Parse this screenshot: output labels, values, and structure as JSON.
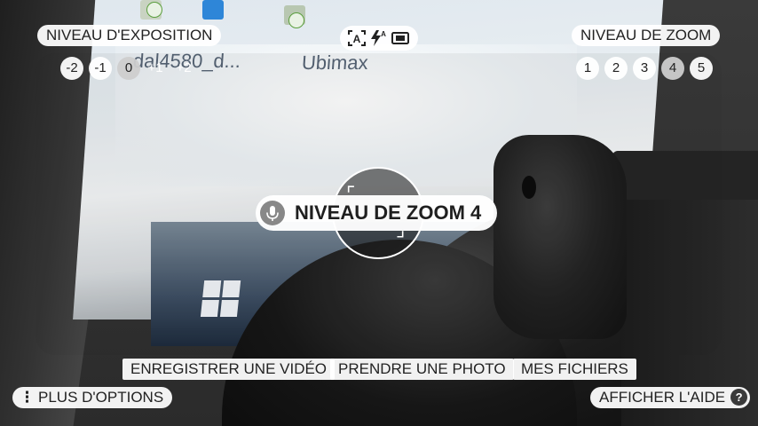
{
  "viewfinder": {
    "desktop_labels": [
      "dal4580_d...",
      "Ubimax"
    ]
  },
  "exposure": {
    "title": "NIVEAU D'EXPOSITION",
    "levels": [
      "-2",
      "-1",
      "0",
      "+1",
      "+2"
    ],
    "selected": "0"
  },
  "mode_icons": [
    "auto-focus-icon",
    "flash-auto-icon",
    "aspect-ratio-icon"
  ],
  "flash_auto_label": "A",
  "focus_auto_label": "A",
  "zoom": {
    "title": "NIVEAU DE ZOOM",
    "levels": [
      "1",
      "2",
      "3",
      "4",
      "5"
    ],
    "selected": "4"
  },
  "toast": {
    "text": "NIVEAU DE ZOOM 4",
    "icon": "microphone-icon"
  },
  "actions": {
    "record_video": "ENREGISTRER UNE VIDÉO",
    "take_photo": "PRENDRE UNE PHOTO",
    "my_files": "MES FICHIERS"
  },
  "more_options": "PLUS D'OPTIONS",
  "show_help": "AFFICHER L'AIDE",
  "help_icon_text": "?",
  "colors": {
    "pill_bg": "#ffffff",
    "text": "#222222",
    "active_level": "#cdcdcd"
  }
}
